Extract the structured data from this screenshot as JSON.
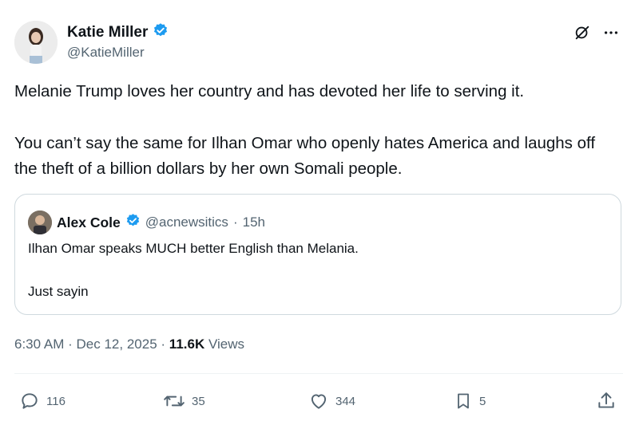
{
  "author": {
    "name": "Katie Miller",
    "handle": "@KatieMiller",
    "verified_color": "#1d9bf0"
  },
  "tweet": {
    "paragraphs": [
      "Melanie Trump loves her country and has devoted her life to serving it.",
      "You can’t say the same for Ilhan Omar who openly hates America and laughs off the theft of a billion dollars by her own Somali people."
    ]
  },
  "quoted": {
    "name": "Alex Cole",
    "handle": "@acnewsitics",
    "separator": "·",
    "time": "15h",
    "lines": [
      "Ilhan Omar speaks MUCH better English than Melania.",
      "Just sayin"
    ]
  },
  "meta": {
    "time": "6:30 AM",
    "dot1": "·",
    "date": "Dec 12, 2025",
    "dot2": "·",
    "views_count": "11.6K",
    "views_label": "Views"
  },
  "actions": {
    "replies": "116",
    "reposts": "35",
    "likes": "344",
    "bookmarks": "5"
  },
  "icons": [
    "grok-icon",
    "more-icon",
    "reply-icon",
    "repost-icon",
    "like-icon",
    "bookmark-icon",
    "share-icon",
    "verified-badge-icon"
  ]
}
